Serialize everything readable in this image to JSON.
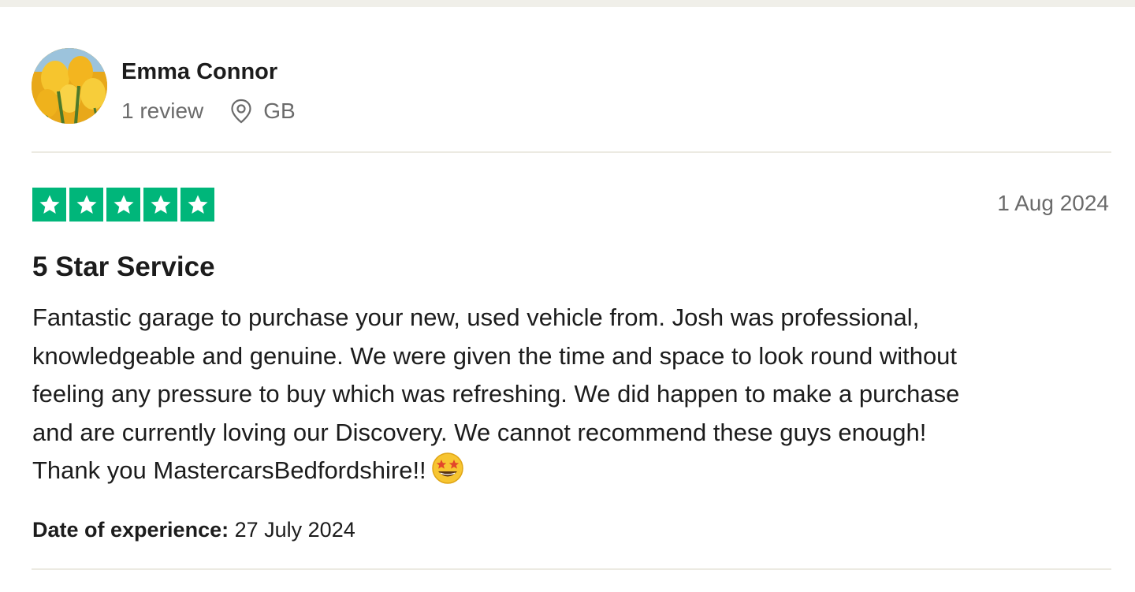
{
  "reviewer": {
    "name": "Emma Connor",
    "review_count": "1 review",
    "country": "GB",
    "avatar_icon": "tulip-photo-avatar",
    "location_icon": "map-pin-icon"
  },
  "review": {
    "rating": 5,
    "rating_max": 5,
    "star_color": "#00b67a",
    "date": "1 Aug 2024",
    "title": "5 Star Service",
    "body_lines": [
      "Fantastic garage to purchase your new, used vehicle from. Josh was professional,",
      "knowledgeable and genuine. We were given the time and space to look round without",
      "feeling any pressure to buy which was refreshing. We did happen to make a purchase",
      "and are currently loving our Discovery. We cannot recommend these guys enough!",
      "Thank you MastercarsBedfordshire!!"
    ],
    "body_emoji": "star-struck-emoji",
    "experience_label": "Date of experience:",
    "experience_date": "27 July 2024"
  }
}
